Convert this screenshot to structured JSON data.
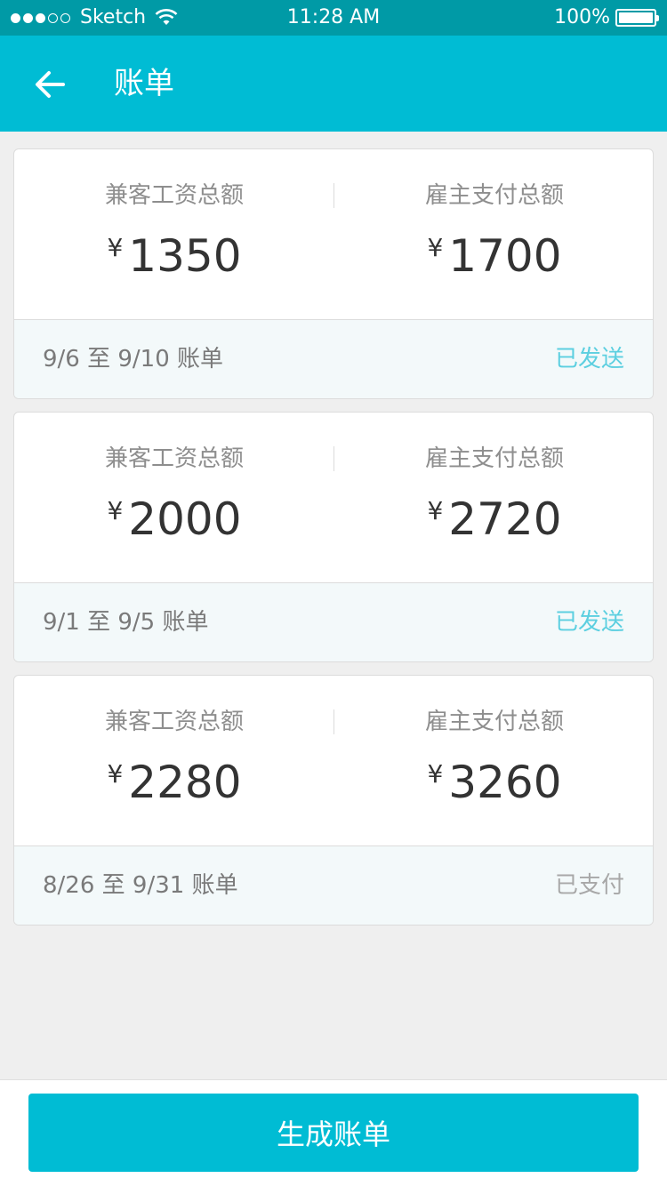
{
  "status_bar": {
    "carrier": "Sketch",
    "time": "11:28 AM",
    "battery": "100%"
  },
  "nav": {
    "title": "账单",
    "back_icon": "arrow-left-icon"
  },
  "bills": [
    {
      "worker_label": "兼客工资总额",
      "worker_currency": "¥",
      "worker_amount": "1350",
      "employer_label": "雇主支付总额",
      "employer_currency": "¥",
      "employer_amount": "1700",
      "period": "9/6 至 9/10 账单",
      "status": "已发送",
      "status_color": "#5ccfe0"
    },
    {
      "worker_label": "兼客工资总额",
      "worker_currency": "¥",
      "worker_amount": "2000",
      "employer_label": "雇主支付总额",
      "employer_currency": "¥",
      "employer_amount": "2720",
      "period": "9/1 至 9/5 账单",
      "status": "已发送",
      "status_color": "#5ccfe0"
    },
    {
      "worker_label": "兼客工资总额",
      "worker_currency": "¥",
      "worker_amount": "2280",
      "employer_label": "雇主支付总额",
      "employer_currency": "¥",
      "employer_amount": "3260",
      "period": "8/26 至 9/31 账单",
      "status": "已支付",
      "status_color": "#a8a8a8"
    }
  ],
  "footer": {
    "generate_label": "生成账单"
  },
  "colors": {
    "accent": "#00bcd4",
    "status_bar": "#009aa6"
  }
}
